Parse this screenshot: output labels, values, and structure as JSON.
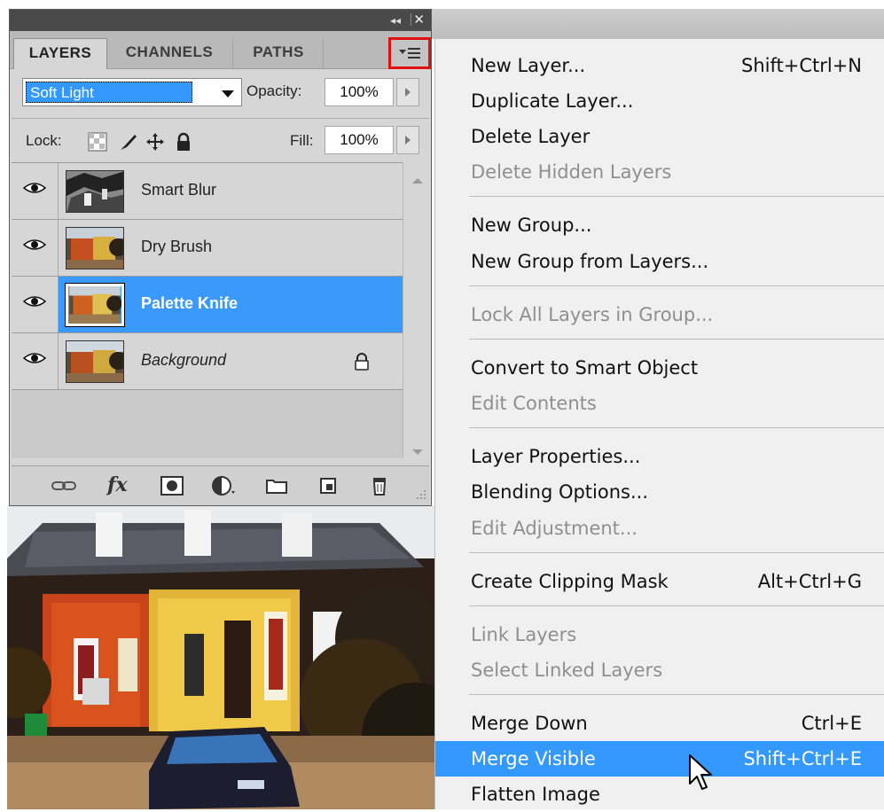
{
  "panel": {
    "title_controls": {
      "collapse": "◂◂",
      "close": "✕"
    },
    "tabs": [
      "LAYERS",
      "CHANNELS",
      "PATHS"
    ],
    "active_tab": "LAYERS",
    "blend_mode": "Soft Light",
    "opacity_label": "Opacity:",
    "opacity_value": "100%",
    "lock_label": "Lock:",
    "fill_label": "Fill:",
    "fill_value": "100%",
    "layers": [
      {
        "name": "Smart Blur",
        "visible": true,
        "selected": false,
        "locked": false
      },
      {
        "name": "Dry Brush",
        "visible": true,
        "selected": false,
        "locked": false
      },
      {
        "name": "Palette Knife",
        "visible": true,
        "selected": true,
        "locked": false
      },
      {
        "name": "Background",
        "visible": true,
        "selected": false,
        "locked": true
      }
    ],
    "bottom_icons": [
      "link-layers-icon",
      "fx-icon",
      "layer-mask-icon",
      "adjustment-layer-icon",
      "new-group-icon",
      "new-layer-icon",
      "trash-icon"
    ],
    "fx_text": "fx"
  },
  "menu": {
    "highlight_color": "#3399ff",
    "items": [
      {
        "label": "New Layer...",
        "shortcut": "Shift+Ctrl+N",
        "enabled": true
      },
      {
        "label": "Duplicate Layer...",
        "shortcut": "",
        "enabled": true
      },
      {
        "label": "Delete Layer",
        "shortcut": "",
        "enabled": true
      },
      {
        "label": "Delete Hidden Layers",
        "shortcut": "",
        "enabled": false
      },
      {
        "label": "New Group...",
        "shortcut": "",
        "enabled": true
      },
      {
        "label": "New Group from Layers...",
        "shortcut": "",
        "enabled": true
      },
      {
        "label": "Lock All Layers in Group...",
        "shortcut": "",
        "enabled": false
      },
      {
        "label": "Convert to Smart Object",
        "shortcut": "",
        "enabled": true
      },
      {
        "label": "Edit Contents",
        "shortcut": "",
        "enabled": false
      },
      {
        "label": "Layer Properties...",
        "shortcut": "",
        "enabled": true
      },
      {
        "label": "Blending Options...",
        "shortcut": "",
        "enabled": true
      },
      {
        "label": "Edit Adjustment...",
        "shortcut": "",
        "enabled": false
      },
      {
        "label": "Create Clipping Mask",
        "shortcut": "Alt+Ctrl+G",
        "enabled": true
      },
      {
        "label": "Link Layers",
        "shortcut": "",
        "enabled": false
      },
      {
        "label": "Select Linked Layers",
        "shortcut": "",
        "enabled": false
      },
      {
        "label": "Merge Down",
        "shortcut": "Ctrl+E",
        "enabled": true
      },
      {
        "label": "Merge Visible",
        "shortcut": "Shift+Ctrl+E",
        "enabled": true,
        "highlighted": true
      },
      {
        "label": "Flatten Image",
        "shortcut": "",
        "enabled": true
      }
    ]
  }
}
